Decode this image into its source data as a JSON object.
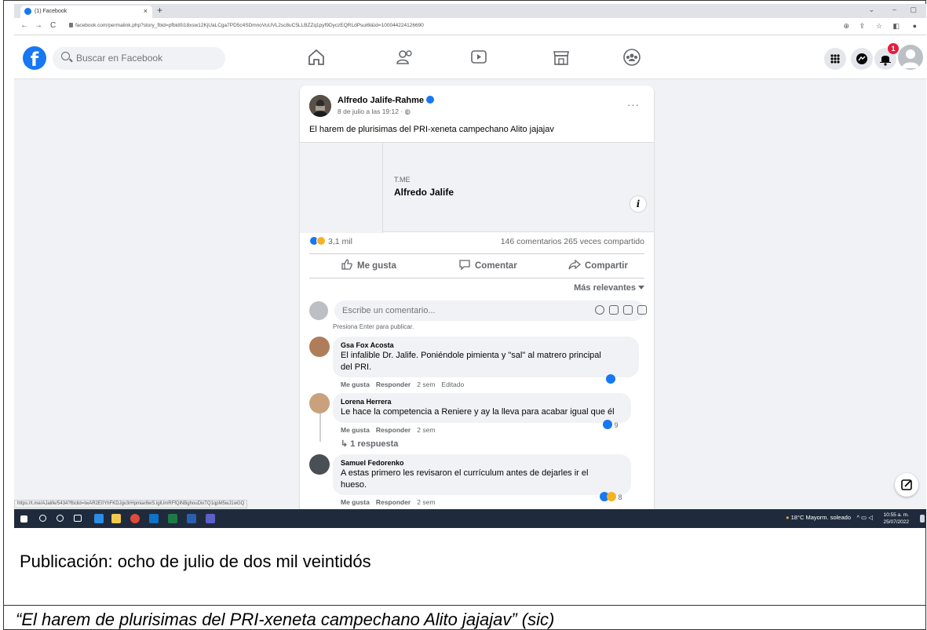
{
  "browser": {
    "tab_title": "(1) Facebook",
    "tab_close": "×",
    "new_tab": "+",
    "url": "facebook.com/permalink.php?story_fbid=pfbid0i18xsw12KjUaLCga7PD5c4SDmnoVuUVL2sc8uC5LLBZZq1pyf9DyczEQRLdPsui6l&id=100044224126690",
    "status_url": "https://t.me/AJalife/5434?fbclid=IwAR2E0YhFKDJgv3rHpmiar8wS.lglUmRFfQiNBghouDixTQ1qpM5wJ1wGQ"
  },
  "facebook": {
    "logo_letter": "f",
    "search_placeholder": "Buscar en Facebook",
    "notification_count": "1"
  },
  "post": {
    "author": "Alfredo Jalife-Rahme",
    "date": "8 de julio a las 19:12 ·",
    "text": "El harem de plurisimas  del PRI-xeneta  campechano Alito jajajav",
    "more": "···",
    "link_domain": "T.ME",
    "link_title": "Alfredo Jalife",
    "info_icon": "i",
    "reactions_count": "3,1 mil",
    "comments_shares": "146 comentarios  265 veces compartido",
    "action_like": "Me gusta",
    "action_comment": "Comentar",
    "action_share": "Compartir",
    "sort_label": "Más relevantes",
    "comment_placeholder": "Escribe un comentario...",
    "enter_hint": "Presiona Enter para publicar."
  },
  "comments": [
    {
      "name": "Gsa Fox Acosta",
      "text_line1": "El infalible Dr. Jalife. Poniéndole pimienta y \"sal\" al matrero principal",
      "text_line2": "del PRI.",
      "like": "Me gusta",
      "reply": "Responder",
      "time": "2 sem",
      "edited": "Editado",
      "reactions": ""
    },
    {
      "name": "Lorena Herrera",
      "text_line1": "Le hace la competencia a Reniere y ay la lleva para acabar igual que él",
      "like": "Me gusta",
      "reply": "Responder",
      "time": "2 sem",
      "reactions": "9",
      "replies": "1 respuesta"
    },
    {
      "name": "Samuel Fedorenko",
      "text_line1": "A estas primero les revisaron el currículum antes de dejarles ir el",
      "text_line2": "hueso.",
      "like": "Me gusta",
      "reply": "Responder",
      "time": "2 sem",
      "reactions": "8"
    }
  ],
  "taskbar": {
    "weather": "18°C  Mayorm. soleado",
    "time": "10:55 a. m.",
    "date": "25/07/2022"
  },
  "captions": {
    "line1": "Publicación: ocho de julio de dos mil veintidós",
    "line2": "“El harem de plurisimas  del PRI-xeneta  campechano Alito jajajav” (sic)"
  },
  "colors": {
    "facebook_blue": "#1877f2",
    "notification_red": "#e41e3f",
    "taskbar": "#1f2b3d",
    "page_bg": "#f0f2f5"
  }
}
